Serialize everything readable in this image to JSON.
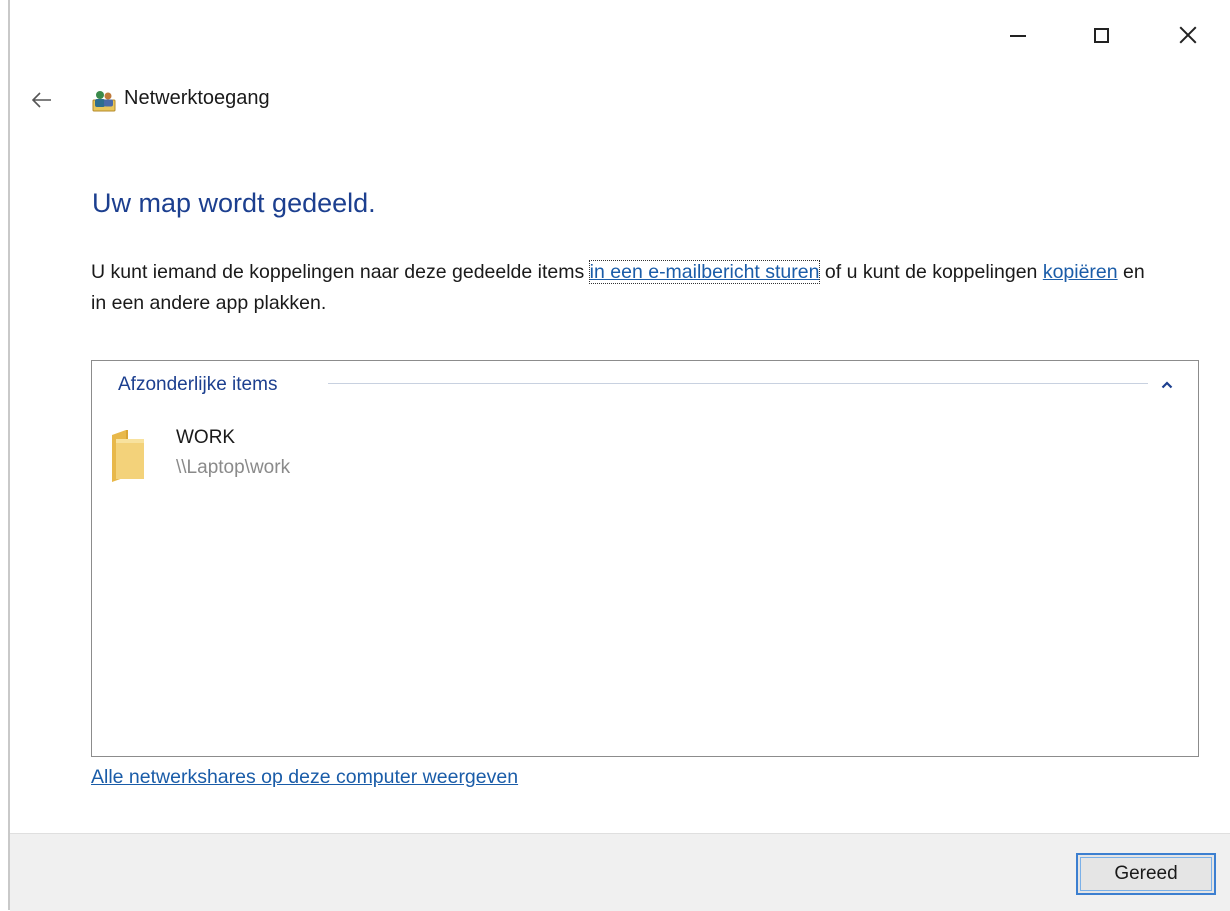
{
  "window": {
    "controls": {
      "minimize_icon": "minimize-icon",
      "maximize_icon": "maximize-icon",
      "close_icon": "close-icon"
    }
  },
  "header": {
    "back_icon": "back-arrow-icon",
    "app_icon": "network-users-icon",
    "title": "Netwerktoegang"
  },
  "main": {
    "heading": "Uw map wordt gedeeld.",
    "body": {
      "text_1": "U kunt iemand de koppelingen naar deze gedeelde items ",
      "link_email": "in een e-mailbericht sturen",
      "text_2": " of u kunt de koppelingen ",
      "link_copy": "kopiëren",
      "text_3": " en in een andere app plakken."
    },
    "items_group": {
      "title": "Afzonderlijke items",
      "collapse_icon": "chevron-up-icon",
      "items": [
        {
          "icon": "folder-icon",
          "name": "WORK",
          "path": "\\\\Laptop\\work"
        }
      ]
    },
    "shares_link": "Alle netwerkshares op deze computer weergeven"
  },
  "footer": {
    "done_label": "Gereed"
  },
  "colors": {
    "heading": "#1c3f8f",
    "link": "#1a5ca8",
    "footer_bg": "#f0f0f0",
    "button_border": "#3c7fd0"
  }
}
